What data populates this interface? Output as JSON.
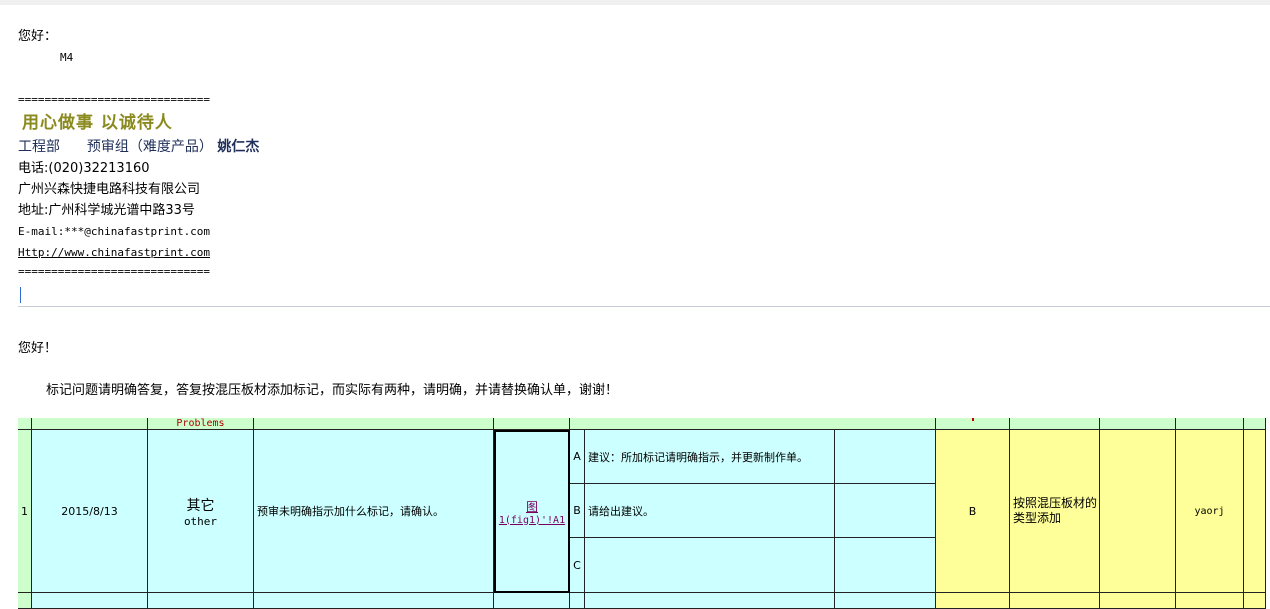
{
  "signature": {
    "greeting": "您好：",
    "recipient": "M4",
    "divider": "=============================",
    "motto": "用心做事  以诚待人",
    "department": "工程部",
    "group": "预审组（难度产品）",
    "name": "姚仁杰",
    "phone": "电话:(020)32213160",
    "company": "广州兴森快捷电路科技有限公司",
    "address": "地址:广州科学城光谱中路33号",
    "email": "E-mail:***@chinafastprint.com",
    "website": "Http://www.chinafastprint.com"
  },
  "message": {
    "greeting": "您好！",
    "body": "标记问题请明确答复，答复按混压板材添加标记，而实际有两种，请明确，并请替换确认单，谢谢！"
  },
  "sheet": {
    "header_problems": "Problems",
    "row_index": "1",
    "date": "2015/8/13",
    "category_cn": "其它",
    "category_en": "other",
    "problem": "预审未明确指示加什么标记，请确认。",
    "ref_line1": "图",
    "ref_line2": "1(fig1)'!A1",
    "options": [
      {
        "key": "A",
        "text": "建议：所加标记请明确指示，并更新制作单。"
      },
      {
        "key": "B",
        "text": "请给出建议。"
      },
      {
        "key": "C",
        "text": ""
      }
    ],
    "answer": "B",
    "reply": "按照混压板材的类型添加",
    "engineer": "yaorj"
  }
}
